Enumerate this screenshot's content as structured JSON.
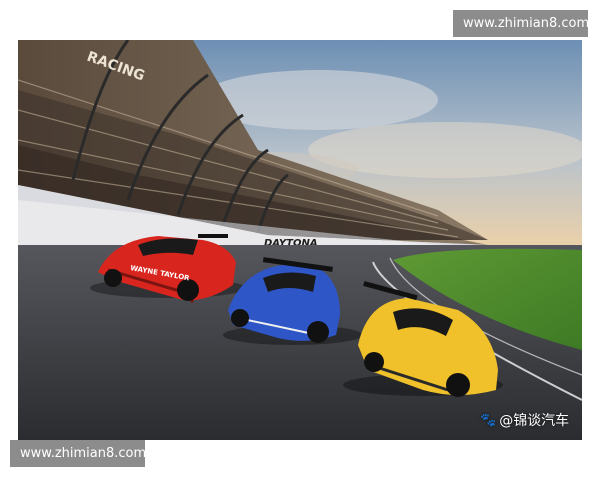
{
  "watermark": {
    "top": "www.zhimian8.com",
    "bottom": "www.zhimian8.com"
  },
  "photo": {
    "credit": "@锦谈汽车",
    "wall_sign": "DAYTONA",
    "stand_sign": "RACING",
    "cars": [
      {
        "name": "red-race-car",
        "color": "#d8261f",
        "livery_text": "WAYNE TAYLOR"
      },
      {
        "name": "blue-race-car",
        "color": "#2f56c7"
      },
      {
        "name": "yellow-race-car",
        "color": "#f0c12b"
      }
    ]
  },
  "colors": {
    "track": "#3a3b3f",
    "grass": "#4f8f2d",
    "sky_top": "#6f93b8",
    "sky_bottom": "#e8c8a0"
  }
}
